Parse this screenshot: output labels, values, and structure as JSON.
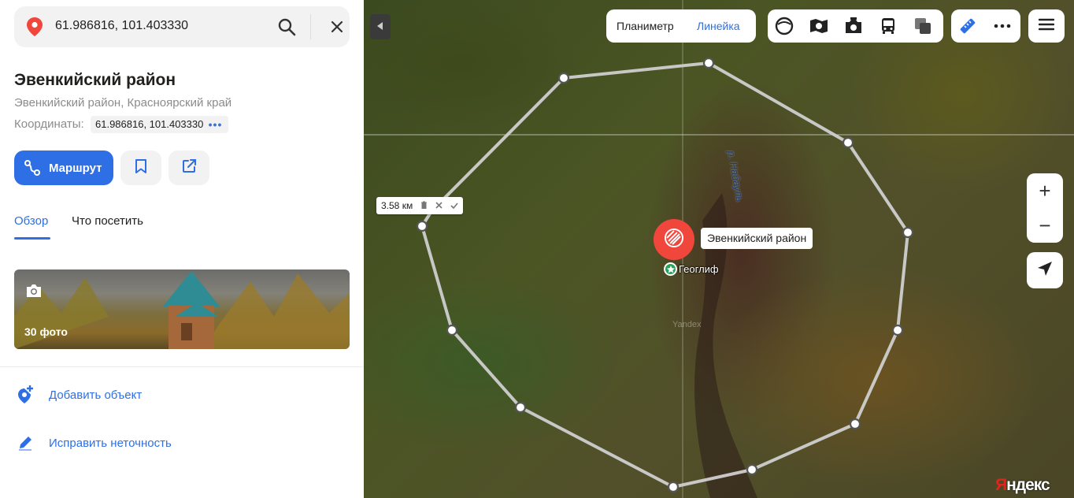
{
  "search": {
    "value": "61.986816, 101.403330",
    "pin_icon": "location-pin-icon",
    "search_icon": "search-icon",
    "close_icon": "close-icon"
  },
  "place": {
    "title": "Эвенкийский район",
    "subtitle": "Эвенкийский район, Красноярский край",
    "coords_label": "Координаты:",
    "coords_value": "61.986816, 101.403330",
    "coords_more": "•••"
  },
  "actions": {
    "route_label": "Маршрут",
    "accent": "#2e6fe5"
  },
  "tabs": [
    {
      "label": "Обзор",
      "active": true
    },
    {
      "label": "Что посетить",
      "active": false
    }
  ],
  "photos": {
    "count_label": "30 фото"
  },
  "links": {
    "add_object": "Добавить объект",
    "fix_error": "Исправить неточность"
  },
  "map": {
    "ruler_tabs": {
      "planimeter": "Планиметр",
      "ruler": "Линейка"
    },
    "distance_label": "3.58 км",
    "marker_label": "Эвенкийский район",
    "poi_label": "Геоглиф",
    "river_label": "р. Набауль",
    "watermark": "Yandex",
    "brand_part1": "Я",
    "brand_part2": "ндекс",
    "zoom_in": "+",
    "zoom_out": "−"
  }
}
